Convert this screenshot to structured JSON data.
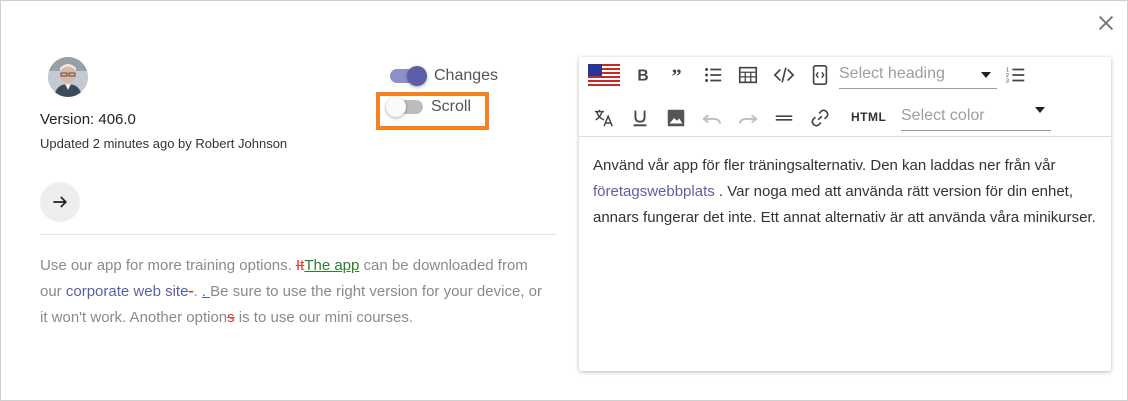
{
  "version": {
    "label": "Version: 406.0"
  },
  "updated": {
    "text": "Updated 2 minutes ago by Robert Johnson"
  },
  "toggles": {
    "changes": {
      "label": "Changes",
      "state": "on"
    },
    "scroll": {
      "label": "Scroll",
      "state": "off"
    }
  },
  "diff": {
    "seg1": "Use our app for more training options. ",
    "del1": "It",
    "ins1": "The app",
    "seg2": " can be downloaded from our ",
    "link1": "corporate web site",
    "del2": "-",
    "seg3": ". ",
    "ins2": ". ",
    "seg4": "Be sure to use the right version for your device, or it won't work. Another option",
    "del3": "s",
    "seg5": " is to use our mini courses."
  },
  "editor": {
    "heading_select": {
      "placeholder": "Select heading"
    },
    "color_select": {
      "placeholder": "Select color"
    },
    "html_button": "HTML",
    "content": {
      "seg1": "Använd vår app för fler träningsalternativ. Den kan laddas ner från vår ",
      "link": "företagswebbplats",
      "seg2": " . Var noga med att använda rätt version för din enhet, annars fungerar det inte. Ett annat alternativ är att använda våra minikurser."
    }
  },
  "icons": {
    "close": "close-icon",
    "next": "arrow-right-icon",
    "language_flag": "us-flag-icon",
    "bold": "bold-icon",
    "quote": "quote-icon",
    "bulleted_list": "bulleted-list-icon",
    "table": "table-icon",
    "code": "code-icon",
    "code_block": "code-block-icon",
    "numbered_list": "numbered-list-icon",
    "translate": "translate-icon",
    "underline": "underline-icon",
    "image": "image-icon",
    "undo": "undo-icon",
    "redo": "redo-icon",
    "horizontal_line": "horizontal-line-icon",
    "link": "link-icon"
  },
  "colors": {
    "accent": "#5c5fa8",
    "highlight": "#f5821f",
    "deleted": "#e53935",
    "inserted": "#2e7d32"
  }
}
